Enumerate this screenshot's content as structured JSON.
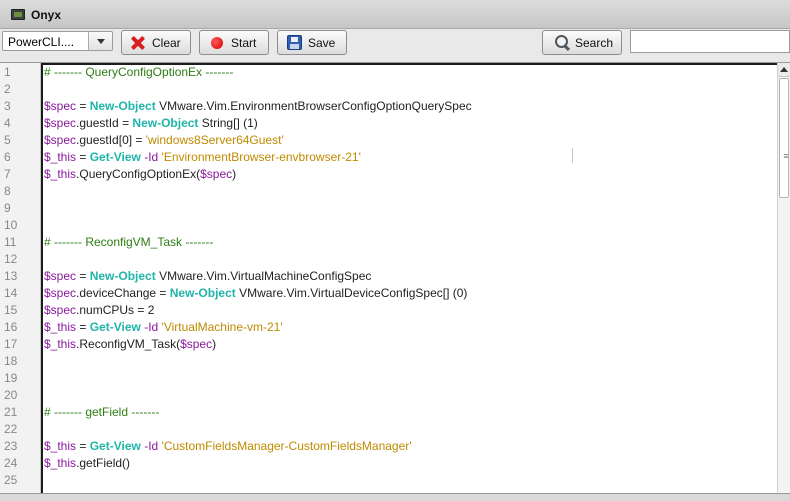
{
  "window": {
    "title": "Onyx",
    "icon": "terminal-icon"
  },
  "toolbar": {
    "language_select": {
      "value": "PowerCLI...."
    },
    "clear_label": "Clear",
    "start_label": "Start",
    "save_label": "Save",
    "search_label": "Search",
    "search_input_value": ""
  },
  "colors": {
    "comment": "#2e7d14",
    "variable": "#8b1a9e",
    "cmdlet": "#1fb5a8",
    "string": "#c08a00"
  },
  "editor": {
    "lines": [
      [
        {
          "t": "comment",
          "v": "# ------- QueryConfigOptionEx -------"
        }
      ],
      [],
      [
        {
          "t": "var",
          "v": "$spec"
        },
        {
          "t": "plain",
          "v": " = "
        },
        {
          "t": "cmd",
          "v": "New-Object"
        },
        {
          "t": "plain",
          "v": " VMware.Vim.EnvironmentBrowserConfigOptionQuerySpec"
        }
      ],
      [
        {
          "t": "var",
          "v": "$spec"
        },
        {
          "t": "plain",
          "v": ".guestId = "
        },
        {
          "t": "cmd",
          "v": "New-Object"
        },
        {
          "t": "plain",
          "v": " String[] (1)"
        }
      ],
      [
        {
          "t": "var",
          "v": "$spec"
        },
        {
          "t": "plain",
          "v": ".guestId[0] = "
        },
        {
          "t": "str",
          "v": "'windows8Server64Guest'"
        }
      ],
      [
        {
          "t": "var",
          "v": "$_this"
        },
        {
          "t": "plain",
          "v": " = "
        },
        {
          "t": "cmd",
          "v": "Get-View"
        },
        {
          "t": "var",
          "v": " -Id"
        },
        {
          "t": "plain",
          "v": " "
        },
        {
          "t": "str",
          "v": "'EnvironmentBrowser-envbrowser-21'"
        }
      ],
      [
        {
          "t": "var",
          "v": "$_this"
        },
        {
          "t": "plain",
          "v": ".QueryConfigOptionEx("
        },
        {
          "t": "var",
          "v": "$spec"
        },
        {
          "t": "plain",
          "v": ")"
        }
      ],
      [],
      [],
      [],
      [
        {
          "t": "comment",
          "v": "# ------- ReconfigVM_Task -------"
        }
      ],
      [],
      [
        {
          "t": "var",
          "v": "$spec"
        },
        {
          "t": "plain",
          "v": " = "
        },
        {
          "t": "cmd",
          "v": "New-Object"
        },
        {
          "t": "plain",
          "v": " VMware.Vim.VirtualMachineConfigSpec"
        }
      ],
      [
        {
          "t": "var",
          "v": "$spec"
        },
        {
          "t": "plain",
          "v": ".deviceChange = "
        },
        {
          "t": "cmd",
          "v": "New-Object"
        },
        {
          "t": "plain",
          "v": " VMware.Vim.VirtualDeviceConfigSpec[] (0)"
        }
      ],
      [
        {
          "t": "var",
          "v": "$spec"
        },
        {
          "t": "plain",
          "v": ".numCPUs = 2"
        }
      ],
      [
        {
          "t": "var",
          "v": "$_this"
        },
        {
          "t": "plain",
          "v": " = "
        },
        {
          "t": "cmd",
          "v": "Get-View"
        },
        {
          "t": "var",
          "v": " -Id"
        },
        {
          "t": "plain",
          "v": " "
        },
        {
          "t": "str",
          "v": "'VirtualMachine-vm-21'"
        }
      ],
      [
        {
          "t": "var",
          "v": "$_this"
        },
        {
          "t": "plain",
          "v": ".ReconfigVM_Task("
        },
        {
          "t": "var",
          "v": "$spec"
        },
        {
          "t": "plain",
          "v": ")"
        }
      ],
      [],
      [],
      [],
      [
        {
          "t": "comment",
          "v": "# ------- getField -------"
        }
      ],
      [],
      [
        {
          "t": "var",
          "v": "$_this"
        },
        {
          "t": "plain",
          "v": " = "
        },
        {
          "t": "cmd",
          "v": "Get-View"
        },
        {
          "t": "var",
          "v": " -Id"
        },
        {
          "t": "plain",
          "v": " "
        },
        {
          "t": "str",
          "v": "'CustomFieldsManager-CustomFieldsManager'"
        }
      ],
      [
        {
          "t": "var",
          "v": "$_this"
        },
        {
          "t": "plain",
          "v": ".getField()"
        }
      ],
      []
    ]
  }
}
